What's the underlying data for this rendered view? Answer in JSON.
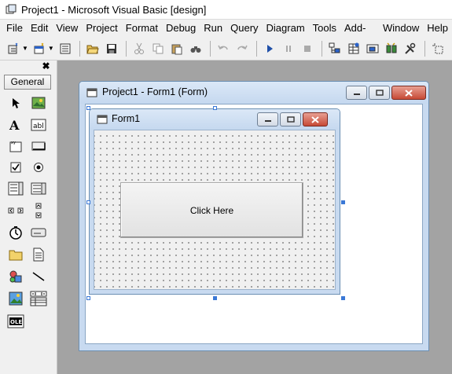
{
  "window": {
    "title": "Project1 - Microsoft Visual Basic [design]"
  },
  "menu": [
    "File",
    "Edit",
    "View",
    "Project",
    "Format",
    "Debug",
    "Run",
    "Query",
    "Diagram",
    "Tools",
    "Add-Ins",
    "Window",
    "Help"
  ],
  "toolbar": {
    "buttons": [
      "add-project",
      "add-form",
      "menu-editor",
      "open-project",
      "save-project",
      "cut",
      "copy",
      "paste",
      "find",
      "undo",
      "redo",
      "start",
      "break",
      "end",
      "project-explorer",
      "properties-window",
      "form-layout",
      "object-browser",
      "toolbox"
    ]
  },
  "toolbox": {
    "tab_label": "General",
    "close_glyph": "✖"
  },
  "designer": {
    "title": "Project1 - Form1 (Form)",
    "form": {
      "title": "Form1",
      "button_caption": "Click Here"
    }
  },
  "colors": {
    "selection_handle": "#3a78d6",
    "close_button": "#c74a36"
  }
}
